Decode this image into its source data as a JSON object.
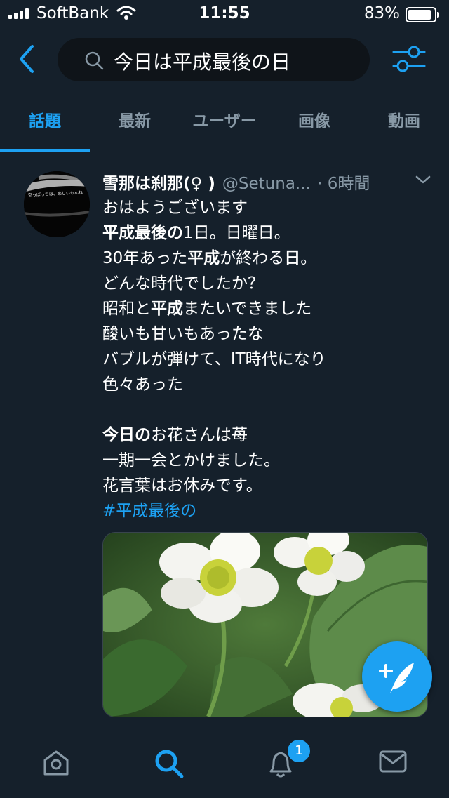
{
  "status_bar": {
    "carrier": "SoftBank",
    "time": "11:55",
    "battery": "83%"
  },
  "search": {
    "query": "今日は平成最後の日"
  },
  "tabs": [
    {
      "label": "話題",
      "active": true
    },
    {
      "label": "最新",
      "active": false
    },
    {
      "label": "ユーザー",
      "active": false
    },
    {
      "label": "画像",
      "active": false
    },
    {
      "label": "動画",
      "active": false
    }
  ],
  "tweet": {
    "display_name": "雪那は刹那(♀ )",
    "handle": "@Setuna...",
    "time": "· 6時間",
    "avatar_text": "空っぽっちは、楽しいもんね",
    "lines": [
      [
        {
          "t": "おはようございます",
          "b": false
        }
      ],
      [
        {
          "t": "平成最後の",
          "b": true
        },
        {
          "t": "1日。日曜日。",
          "b": false
        }
      ],
      [
        {
          "t": "30年あった",
          "b": false
        },
        {
          "t": "平成",
          "b": true
        },
        {
          "t": "が終わる",
          "b": false
        },
        {
          "t": "日",
          "b": true
        },
        {
          "t": "。",
          "b": false
        }
      ],
      [
        {
          "t": "どんな時代でしたか？",
          "b": false
        }
      ],
      [
        {
          "t": "昭和と",
          "b": false
        },
        {
          "t": "平成",
          "b": true
        },
        {
          "t": "またいできました",
          "b": false
        }
      ],
      [
        {
          "t": "酸いも甘いもあったな",
          "b": false
        }
      ],
      [
        {
          "t": "バブルが弾けて、IT時代になり",
          "b": false
        }
      ],
      [
        {
          "t": "色々あった",
          "b": false
        }
      ],
      [
        {
          "t": "",
          "b": false
        }
      ],
      [
        {
          "t": "今日の",
          "b": true
        },
        {
          "t": "お花さんは苺",
          "b": false
        }
      ],
      [
        {
          "t": "一期一会とかけました。",
          "b": false
        }
      ],
      [
        {
          "t": "花言葉はお休みです。",
          "b": false
        }
      ]
    ],
    "hashtag": "#平成最後の"
  },
  "notifications_badge": "1",
  "colors": {
    "background": "#15202b",
    "accent": "#1da1f2",
    "muted": "#8899a6",
    "divider": "#38444d"
  },
  "icons": [
    "back-icon",
    "search-icon",
    "filter-icon",
    "chevron-down-icon",
    "compose-icon",
    "home-icon",
    "explore-icon",
    "notifications-icon",
    "messages-icon"
  ]
}
